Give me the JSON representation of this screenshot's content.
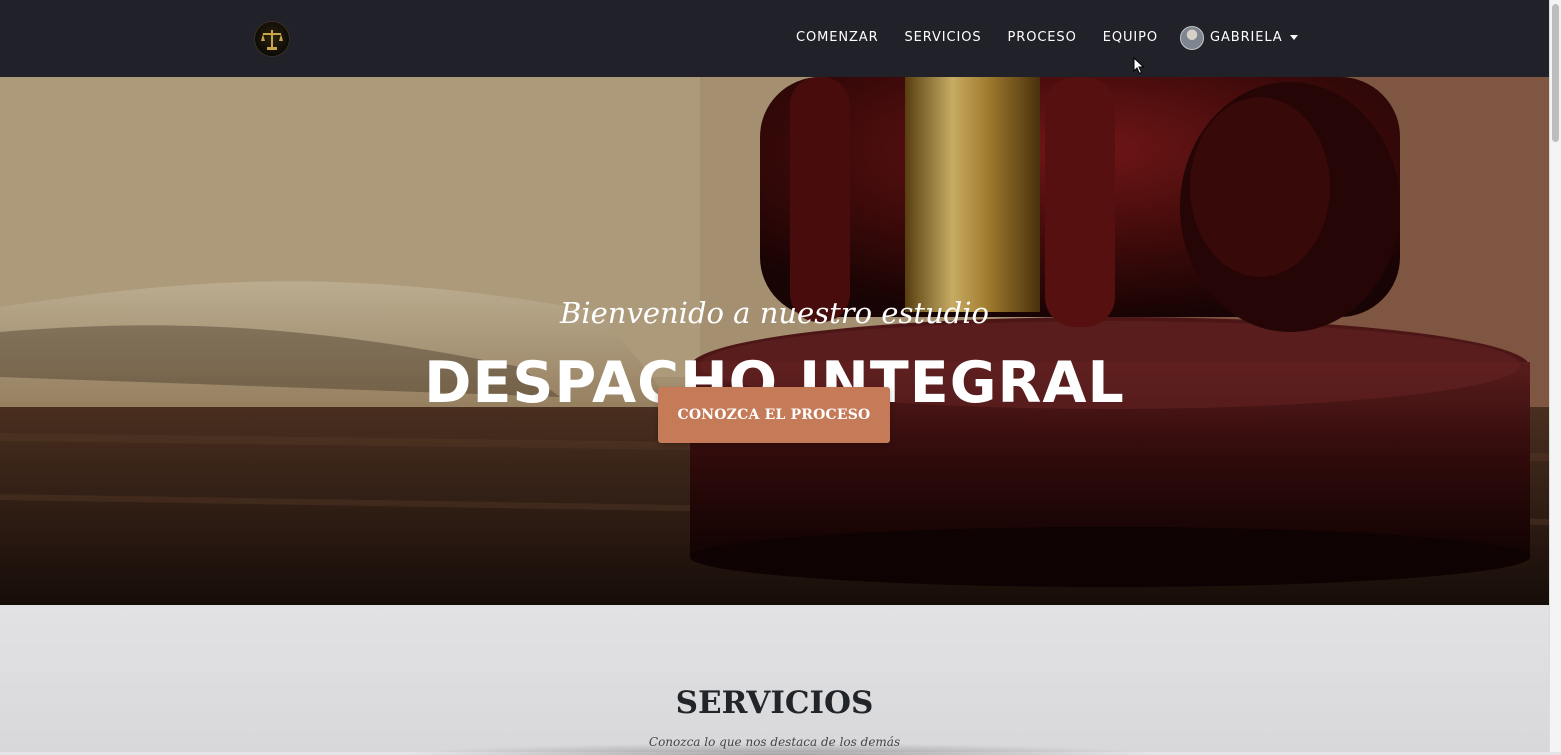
{
  "navbar": {
    "logo_icon": "scales-of-justice-icon",
    "links": [
      "COMENZAR",
      "SERVICIOS",
      "PROCESO",
      "EQUIPO"
    ],
    "user": {
      "name": "GABRIELA",
      "avatar_icon": "user-avatar-icon",
      "caret_icon": "caret-down-icon"
    }
  },
  "hero": {
    "subtitle": "Bienvenido a nuestro estudio",
    "title": "DESPACHO INTEGRAL",
    "button_label": "CONOZCA EL PROCESO",
    "background_icon": "judge-gavel-image"
  },
  "services": {
    "title": "SERVICIOS",
    "subtitle": "Conozca lo que nos destaca de los demás"
  },
  "colors": {
    "navbar_bg": "#212129",
    "accent": "#c67b58",
    "section_bg": "#e2e1e4"
  }
}
